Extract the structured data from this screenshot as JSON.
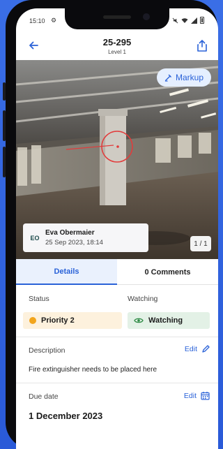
{
  "status_bar": {
    "time": "15:10"
  },
  "header": {
    "title": "25-295",
    "subtitle": "Level 1"
  },
  "photo": {
    "markup_label": "Markup",
    "author_initials": "EO",
    "author_name": "Eva Obermaier",
    "author_date": "25 Sep 2023, 18:14",
    "page_counter": "1 / 1"
  },
  "tabs": [
    {
      "label": "Details",
      "active": true
    },
    {
      "label": "0 Comments",
      "active": false
    }
  ],
  "details": {
    "status_label": "Status",
    "status_value": "Priority 2",
    "status_color": "#f2a51c",
    "watching_label": "Watching",
    "watching_value": "Watching",
    "description_label": "Description",
    "description_edit": "Edit",
    "description_text": "Fire extinguisher needs to be placed here",
    "due_label": "Due date",
    "due_edit": "Edit",
    "due_value": "1 December 2023"
  },
  "colors": {
    "accent": "#2a62d8",
    "priority_chip": "#fdf1dd",
    "watching_chip": "#e3f1e6"
  }
}
